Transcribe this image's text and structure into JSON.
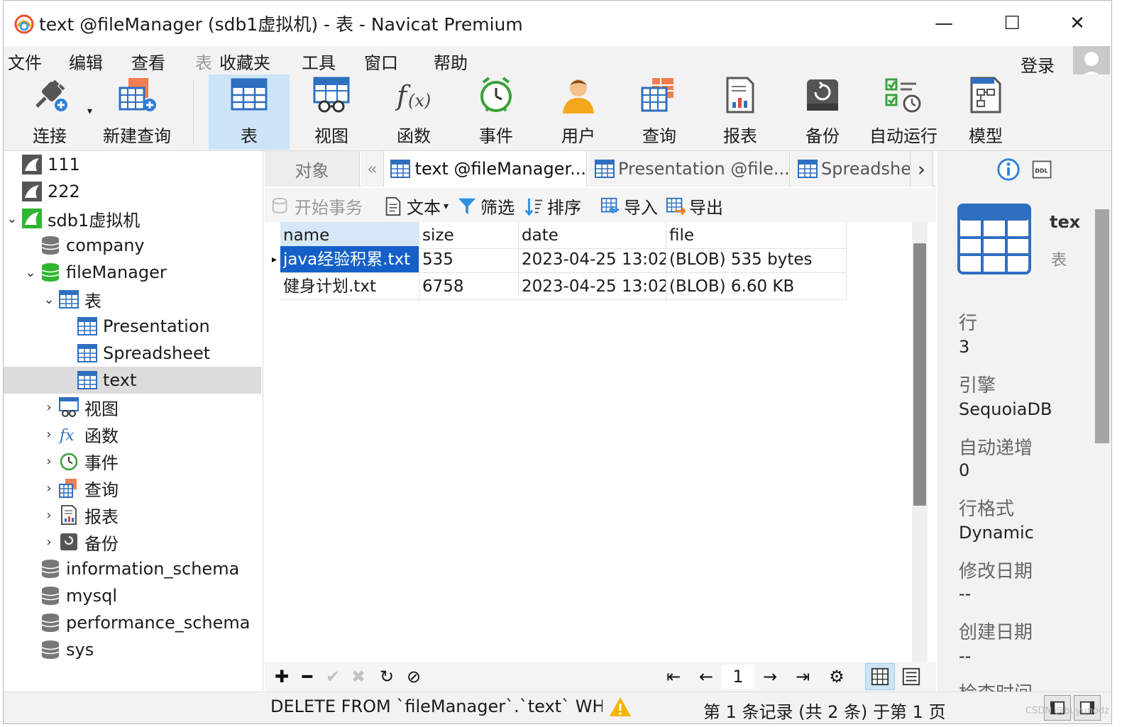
{
  "window": {
    "title": "text @fileManager (sdb1虚拟机) - 表 - Navicat Premium",
    "minimize": "—",
    "maximize": "☐",
    "close": "✕"
  },
  "menu": {
    "items": [
      "文件",
      "编辑",
      "查看",
      "表",
      "收藏夹",
      "工具",
      "窗口",
      "帮助"
    ],
    "login": "登录"
  },
  "toolbar": {
    "items": [
      {
        "label": "连接",
        "icon": "plug-connect-icon"
      },
      {
        "label": "新建查询",
        "icon": "new-query-icon"
      },
      {
        "label": "表",
        "icon": "table-icon",
        "active": true
      },
      {
        "label": "视图",
        "icon": "view-icon"
      },
      {
        "label": "函数",
        "icon": "function-icon"
      },
      {
        "label": "事件",
        "icon": "event-clock-icon"
      },
      {
        "label": "用户",
        "icon": "user-icon"
      },
      {
        "label": "查询",
        "icon": "query-icon"
      },
      {
        "label": "报表",
        "icon": "report-icon"
      },
      {
        "label": "备份",
        "icon": "backup-icon"
      },
      {
        "label": "自动运行",
        "icon": "automation-icon"
      },
      {
        "label": "模型",
        "icon": "model-icon"
      }
    ]
  },
  "tree": {
    "nodes": [
      {
        "label": "111",
        "icon": "mysql-connection-icon"
      },
      {
        "label": "222",
        "icon": "mysql-connection-icon"
      },
      {
        "label": "sdb1虚拟机",
        "icon": "connection-active-icon",
        "expanded": true
      },
      {
        "label": "company",
        "icon": "database-icon"
      },
      {
        "label": "fileManager",
        "icon": "database-active-icon",
        "expanded": true
      },
      {
        "label": "表",
        "icon": "table-folder-icon",
        "expanded": true
      },
      {
        "label": "Presentation",
        "icon": "table-icon"
      },
      {
        "label": "Spreadsheet",
        "icon": "table-icon"
      },
      {
        "label": "text",
        "icon": "table-icon",
        "selected": true
      },
      {
        "label": "视图",
        "icon": "view-icon"
      },
      {
        "label": "函数",
        "icon": "function-icon"
      },
      {
        "label": "事件",
        "icon": "event-clock-icon"
      },
      {
        "label": "查询",
        "icon": "query-icon"
      },
      {
        "label": "报表",
        "icon": "report-icon"
      },
      {
        "label": "备份",
        "icon": "backup-icon"
      },
      {
        "label": "information_schema",
        "icon": "database-icon"
      },
      {
        "label": "mysql",
        "icon": "database-icon"
      },
      {
        "label": "performance_schema",
        "icon": "database-icon"
      },
      {
        "label": "sys",
        "icon": "database-icon"
      }
    ]
  },
  "tabs": {
    "objects": "对象",
    "items": [
      "text @fileManager...",
      "Presentation @file...",
      "Spreadshe"
    ]
  },
  "table_toolbar": {
    "begin_tx": "开始事务",
    "text": "文本",
    "filter": "筛选",
    "sort": "排序",
    "import": "导入",
    "export": "导出"
  },
  "grid": {
    "columns": [
      "name",
      "size",
      "date",
      "file"
    ],
    "rows": [
      [
        "java经验积累.txt",
        "535",
        "2023-04-25 13:02:",
        "(BLOB) 535 bytes"
      ],
      [
        "健身计划.txt",
        "6758",
        "2023-04-25 13:02:",
        "(BLOB) 6.60 KB"
      ]
    ],
    "page": "1"
  },
  "info": {
    "name": "tex",
    "type": "表",
    "props": [
      {
        "label": "行",
        "value": "3"
      },
      {
        "label": "引擎",
        "value": "SequoiaDB"
      },
      {
        "label": "自动递增",
        "value": "0"
      },
      {
        "label": "行格式",
        "value": "Dynamic"
      },
      {
        "label": "修改日期",
        "value": "--"
      },
      {
        "label": "创建日期",
        "value": "--"
      },
      {
        "label": "检查时间",
        "value": ""
      }
    ]
  },
  "status": {
    "sql": "DELETE FROM `fileManager`.`text` WHERE",
    "records": "第 1 条记录 (共 2 条) 于第 1 页",
    "watermark": "CSDN @buyunodz"
  },
  "colors": {
    "accent": "#1460c8",
    "active_tab_bg": "#cce4f7",
    "table_blue": "#2f6fc0",
    "green_db": "#2fb52f"
  }
}
